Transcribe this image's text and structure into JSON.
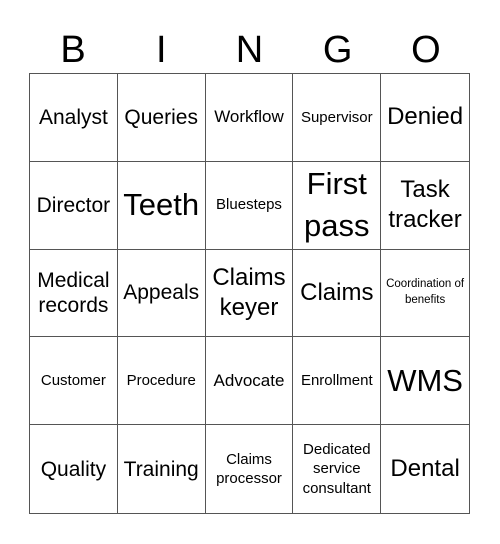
{
  "header": [
    "B",
    "I",
    "N",
    "G",
    "O"
  ],
  "cells": [
    {
      "text": "Analyst",
      "size": "m"
    },
    {
      "text": "Queries",
      "size": "m"
    },
    {
      "text": "Workflow",
      "size": "n"
    },
    {
      "text": "Supervisor",
      "size": "s"
    },
    {
      "text": "Denied",
      "size": "l"
    },
    {
      "text": "Director",
      "size": "m"
    },
    {
      "text": "Teeth",
      "size": "xl"
    },
    {
      "text": "Bluesteps",
      "size": "s"
    },
    {
      "text": "First pass",
      "size": "xl"
    },
    {
      "text": "Task tracker",
      "size": "l"
    },
    {
      "text": "Medical records",
      "size": "m"
    },
    {
      "text": "Appeals",
      "size": "m"
    },
    {
      "text": "Claims keyer",
      "size": "l"
    },
    {
      "text": "Claims",
      "size": "l"
    },
    {
      "text": "Coordination of benefits",
      "size": "xs"
    },
    {
      "text": "Customer",
      "size": "s"
    },
    {
      "text": "Procedure",
      "size": "s"
    },
    {
      "text": "Advocate",
      "size": "n"
    },
    {
      "text": "Enrollment",
      "size": "s"
    },
    {
      "text": "WMS",
      "size": "xl"
    },
    {
      "text": "Quality",
      "size": "m"
    },
    {
      "text": "Training",
      "size": "m"
    },
    {
      "text": "Claims processor",
      "size": "s"
    },
    {
      "text": "Dedicated service consultant",
      "size": "s"
    },
    {
      "text": "Dental",
      "size": "l"
    }
  ]
}
